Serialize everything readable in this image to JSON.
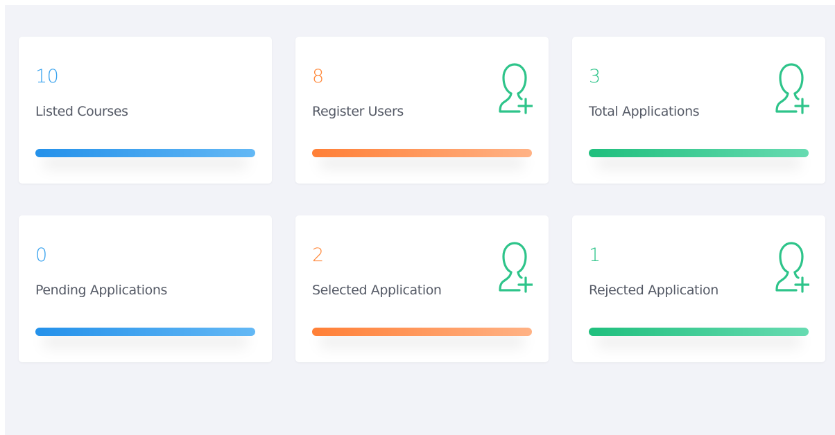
{
  "stats": [
    {
      "value": "10",
      "label": "Listed Courses",
      "color": "#3aa3ee",
      "icon": null
    },
    {
      "value": "8",
      "label": "Register Users",
      "color": "#ff8a3d",
      "icon": "add-user-icon"
    },
    {
      "value": "3",
      "label": "Total Applications",
      "color": "#2ec48a",
      "icon": "add-user-icon"
    },
    {
      "value": "0",
      "label": "Pending Applications",
      "color": "#3aa3ee",
      "icon": null
    },
    {
      "value": "2",
      "label": "Selected Application",
      "color": "#ff8a3d",
      "icon": "add-user-icon"
    },
    {
      "value": "1",
      "label": "Rejected Application",
      "color": "#2ec48a",
      "icon": "add-user-icon"
    }
  ],
  "colors": {
    "page_background": "#f2f3f8",
    "card_background": "#ffffff",
    "icon_color": "#2ec48a",
    "label_color": "#555a66"
  }
}
